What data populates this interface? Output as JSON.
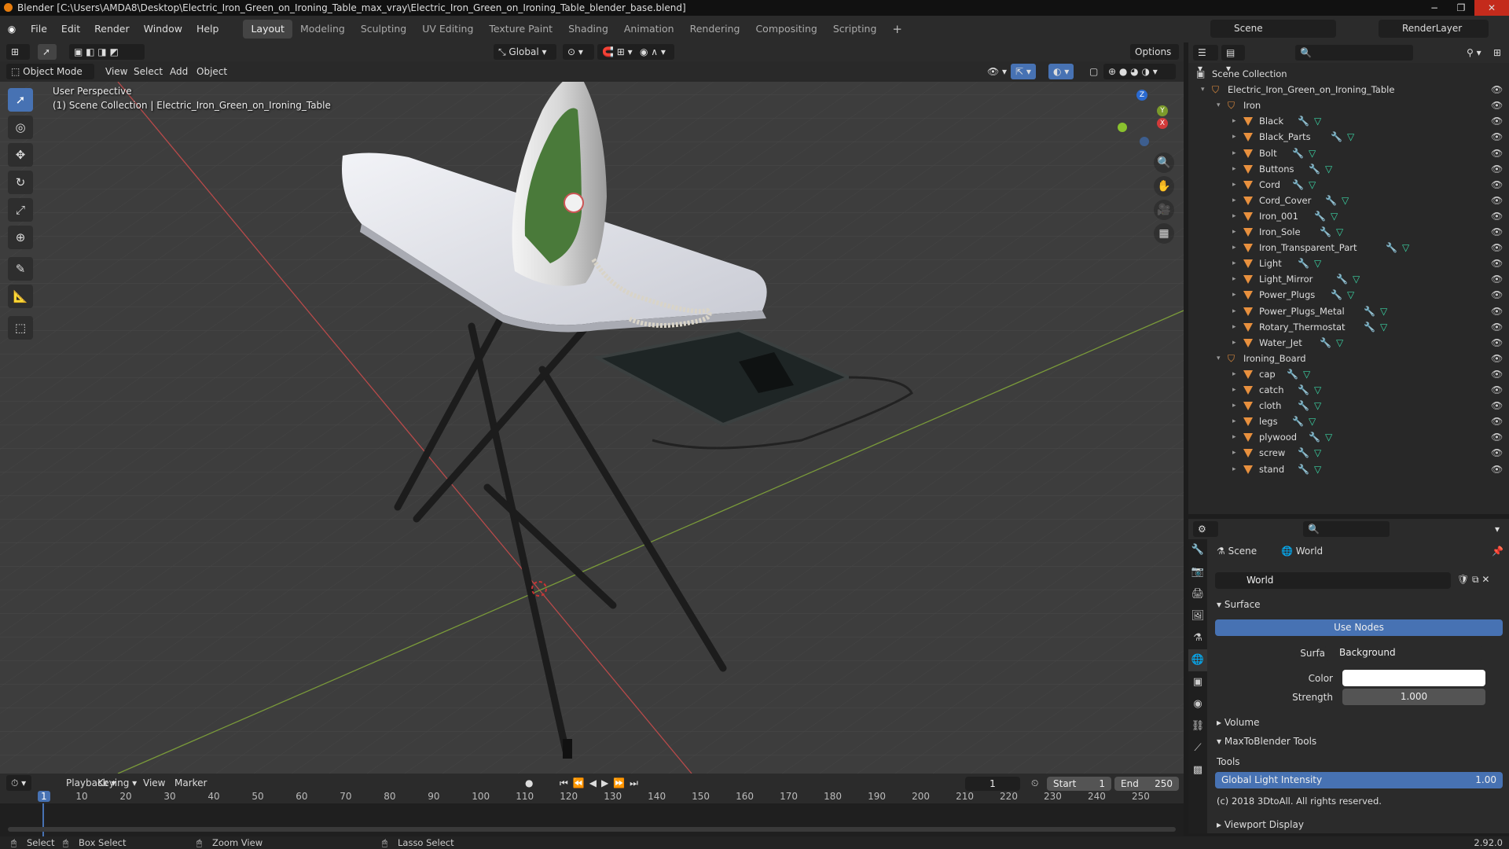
{
  "window": {
    "title": "Blender [C:\\Users\\AMDA8\\Desktop\\Electric_Iron_Green_on_Ironing_Table_max_vray\\Electric_Iron_Green_on_Ironing_Table_blender_base.blend]",
    "minimize": "−",
    "maximize": "❐",
    "close": "✕"
  },
  "menu": [
    "File",
    "Edit",
    "Render",
    "Window",
    "Help"
  ],
  "workspaces": [
    "Layout",
    "Modeling",
    "Sculpting",
    "UV Editing",
    "Texture Paint",
    "Shading",
    "Animation",
    "Rendering",
    "Compositing",
    "Scripting"
  ],
  "workspace_add": "+",
  "scene_name": "Scene",
  "render_layer": "RenderLayer",
  "header": {
    "transform_orientation": "Global",
    "options": "Options"
  },
  "viewport_header": {
    "mode": "Object Mode",
    "items": [
      "View",
      "Select",
      "Add",
      "Object"
    ]
  },
  "viewport": {
    "perspective": "User Perspective",
    "collection_info": "(1) Scene Collection | Electric_Iron_Green_on_Ironing_Table"
  },
  "gizmo": {
    "x": "X",
    "y": "Y",
    "z": "Z"
  },
  "tools": [
    {
      "name": "select-box-tool",
      "glyph": "➚"
    },
    {
      "name": "cursor-tool",
      "glyph": "◎"
    },
    {
      "name": "move-tool",
      "glyph": "✥"
    },
    {
      "name": "rotate-tool",
      "glyph": "↻"
    },
    {
      "name": "scale-tool",
      "glyph": "⤢"
    },
    {
      "name": "transform-tool",
      "glyph": "⊕"
    },
    {
      "name": "annotate-tool",
      "glyph": "✎"
    },
    {
      "name": "measure-tool",
      "glyph": "📐"
    },
    {
      "name": "add-cube-tool",
      "glyph": "⬚"
    }
  ],
  "outliner": {
    "root": "Scene Collection",
    "collection": "Electric_Iron_Green_on_Ironing_Table",
    "groups": [
      {
        "name": "Iron",
        "items": [
          "Black",
          "Black_Parts",
          "Bolt",
          "Buttons",
          "Cord",
          "Cord_Cover",
          "Iron_001",
          "Iron_Sole",
          "Iron_Transparent_Part",
          "Light",
          "Light_Mirror",
          "Power_Plugs",
          "Power_Plugs_Metal",
          "Rotary_Thermostat",
          "Water_Jet"
        ]
      },
      {
        "name": "Ironing_Board",
        "items": [
          "cap",
          "catch",
          "cloth",
          "legs",
          "plywood",
          "screw",
          "stand"
        ]
      }
    ]
  },
  "properties": {
    "breadcrumb_scene": "Scene",
    "breadcrumb_world": "World",
    "world_name": "World",
    "surface_panel": "Surface",
    "use_nodes": "Use Nodes",
    "surface_label": "Surface",
    "surface_value": "Background",
    "color_label": "Color",
    "color_value": "#ffffff",
    "strength_label": "Strength",
    "strength_value": "1.000",
    "volume_panel": "Volume",
    "max_panel": "MaxToBlender Tools",
    "tools_label": "Tools",
    "global_light_label": "Global Light Intensity",
    "global_light_value": "1.00",
    "copyright": "(c) 2018 3DtoAll. All rights reserved.",
    "viewport_display": "Viewport Display"
  },
  "timeline": {
    "menus": [
      "Playback",
      "Keying",
      "View",
      "Marker"
    ],
    "current_frame": "1",
    "start_label": "Start",
    "start_value": "1",
    "end_label": "End",
    "end_value": "250",
    "ticks": [
      "1",
      "10",
      "20",
      "30",
      "40",
      "50",
      "60",
      "70",
      "80",
      "90",
      "100",
      "110",
      "120",
      "130",
      "140",
      "150",
      "160",
      "170",
      "180",
      "190",
      "200",
      "210",
      "220",
      "230",
      "240",
      "250"
    ]
  },
  "status": {
    "select": "Select",
    "box_select": "Box Select",
    "zoom_view": "Zoom View",
    "lasso_select": "Lasso Select",
    "version": "2.92.0"
  }
}
